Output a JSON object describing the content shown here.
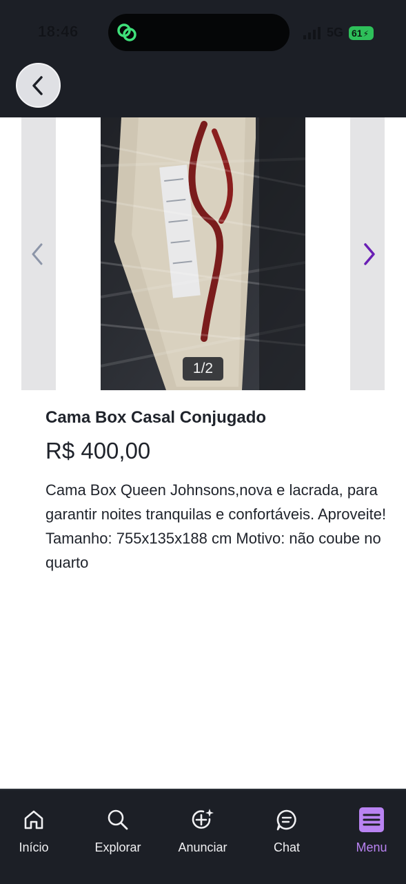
{
  "status_bar": {
    "time": "18:46",
    "network": "5G",
    "battery": "61"
  },
  "header": {
    "back_icon": "chevron-left-icon"
  },
  "carousel": {
    "counter": "1/2",
    "prev_icon": "chevron-left-icon",
    "next_icon": "chevron-right-icon"
  },
  "listing": {
    "title": "Cama Box Casal Conjugado",
    "price": "R$ 400,00",
    "description": "Cama Box Queen Johnsons,nova e lacrada, para garantir noites tranquilas e confortáveis. Aproveite! Tamanho: 755x135x188 cm Motivo: não coube no quarto"
  },
  "bottom_nav": {
    "items": [
      {
        "label": "Início",
        "icon": "home-icon"
      },
      {
        "label": "Explorar",
        "icon": "search-icon"
      },
      {
        "label": "Anunciar",
        "icon": "add-sparkle-icon"
      },
      {
        "label": "Chat",
        "icon": "chat-bubble-icon"
      },
      {
        "label": "Menu",
        "icon": "menu-icon",
        "active": true
      }
    ]
  },
  "colors": {
    "dark_bg": "#1c1f26",
    "accent_purple": "#b983f2",
    "arrow_purple": "#6a1fb5",
    "battery_green": "#2ec05a"
  }
}
